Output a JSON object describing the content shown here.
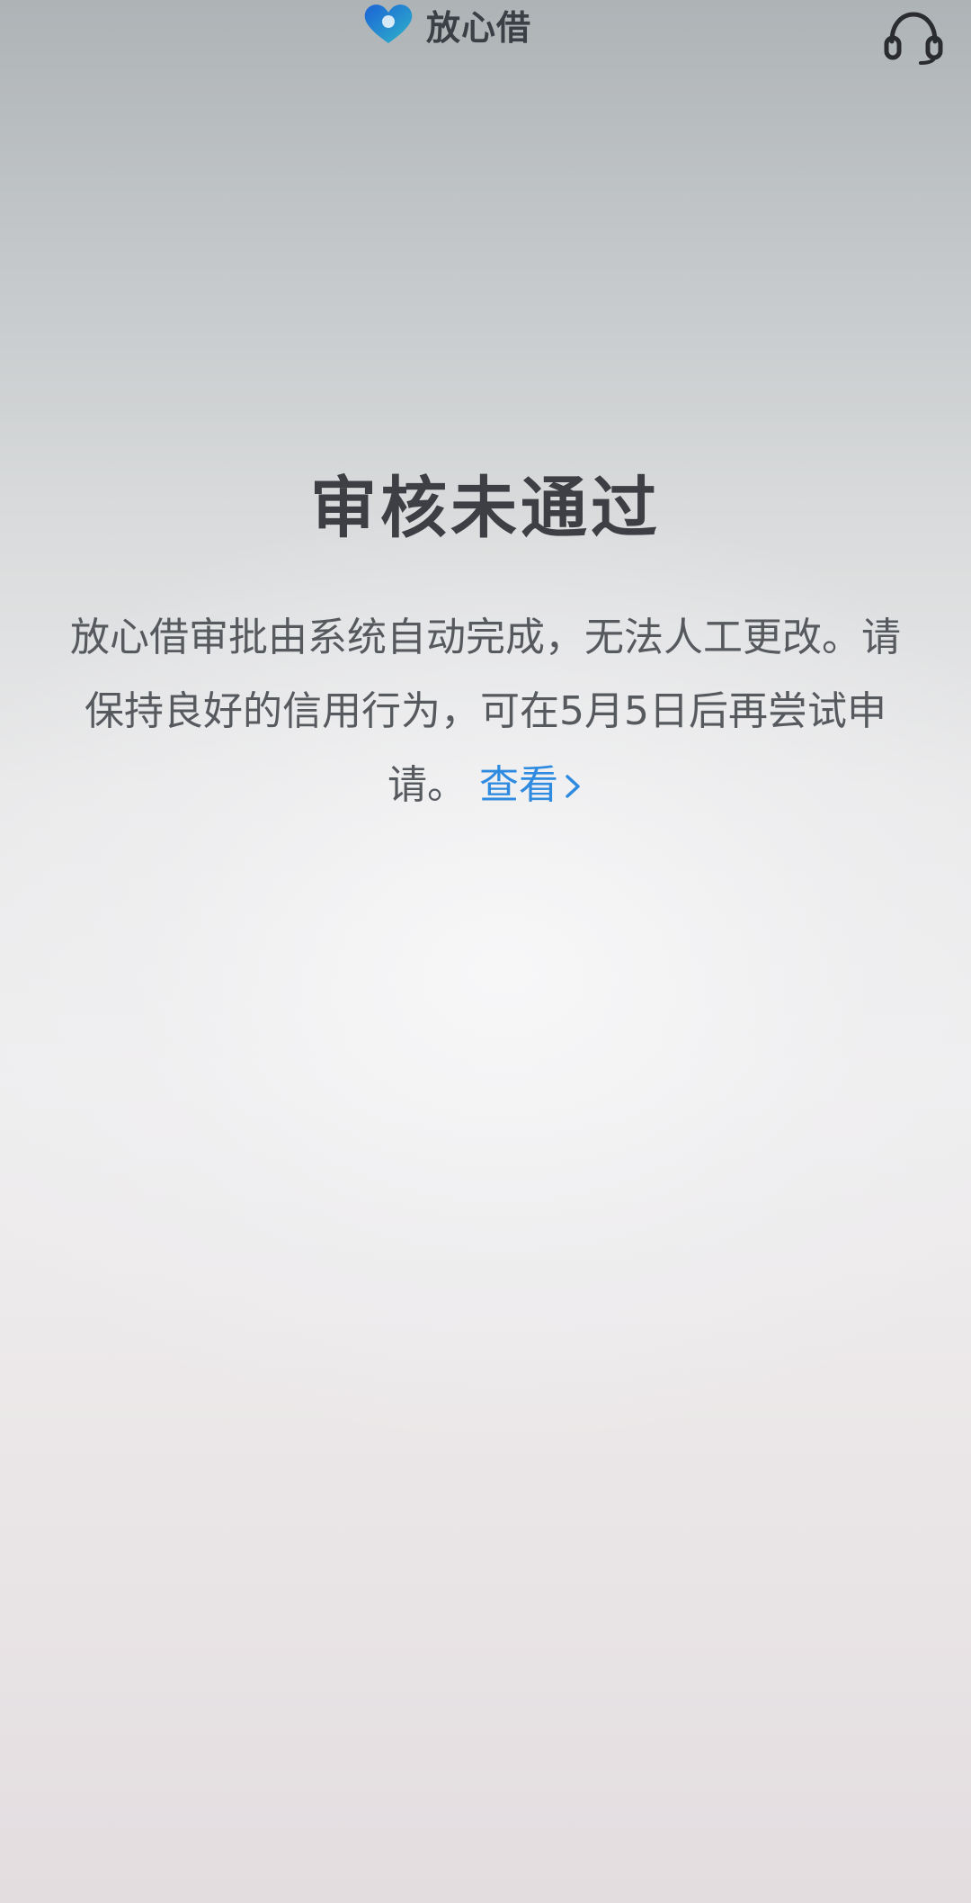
{
  "header": {
    "brand_name": "放心借",
    "logo_icon": "heart-logo-icon",
    "support_icon": "headset-icon"
  },
  "result": {
    "title": "审核未通过",
    "description": "放心借审批由系统自动完成，无法人工更改。请保持良好的信用行为，可在5月5日后再尝试申请。",
    "link_label": "查看",
    "link_icon": "chevron-right-icon"
  },
  "colors": {
    "brand_blue": "#1e6fd9",
    "brand_teal": "#2fb5c9",
    "link": "#2f8be0",
    "title_text": "#3d3f44",
    "body_text": "#56595e"
  }
}
